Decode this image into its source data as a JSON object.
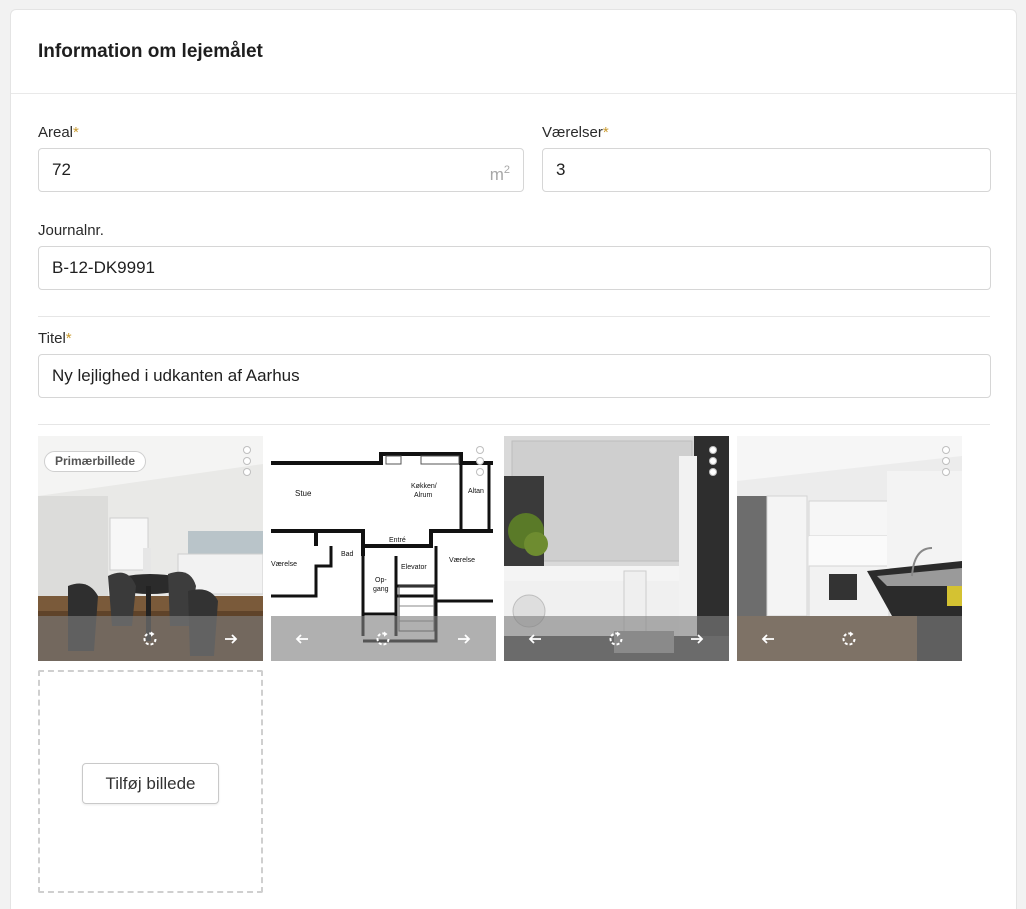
{
  "section": {
    "title": "Information om lejemålet"
  },
  "fields": {
    "areal": {
      "label": "Areal",
      "required_mark": "*",
      "value": "72",
      "unit_base": "m",
      "unit_exp": "2"
    },
    "vaerelser": {
      "label": "Værelser",
      "required_mark": "*",
      "value": "3"
    },
    "journalnr": {
      "label": "Journalnr.",
      "value": "B-12-DK9991"
    },
    "titel": {
      "label": "Titel",
      "required_mark": "*",
      "value": "Ny lejlighed i udkanten af Aarhus"
    }
  },
  "images": {
    "primary_badge": "Primærbillede",
    "items": [
      {
        "subject": "living-room-dining"
      },
      {
        "subject": "floor-plan",
        "labels": [
          "Stue",
          "Køkken/",
          "Alrum",
          "Altan",
          "Entré",
          "Bad",
          "Værelse",
          "Elevator",
          "Værelse",
          "Op-",
          "gang"
        ]
      },
      {
        "subject": "bathroom"
      },
      {
        "subject": "kitchen"
      }
    ],
    "add_button": "Tilføj billede"
  },
  "colors": {
    "required_mark": "#c99a2e",
    "overlay": "rgba(128,128,128,0.62)"
  }
}
